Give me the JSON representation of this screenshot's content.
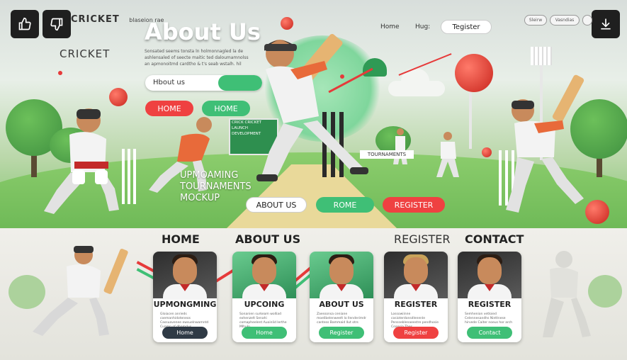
{
  "toolbar": {
    "like_icon": "thumbs-up-icon",
    "dislike_icon": "thumbs-down-icon",
    "download_icon": "download-icon"
  },
  "brand": {
    "name": "CRICKET",
    "tagline": "blaseion rae"
  },
  "hero": {
    "cricket_word": "CRICKET",
    "title": "About Us",
    "subtitle": "Sonsated seems tonsta ln holmonnagled la de ashlensaled of seecte maitic ted daloumamnolss an apmonoitmd cardtho & t's seab wstalh. hil",
    "search_text": "Hbout us",
    "btn_home_red": "HOME",
    "btn_home_green": "HOME",
    "stadium_text": "CRICK CRICKET LAUNCH DEVELOPMENT",
    "tournaments_label": "TOURNAMENTS",
    "upcoming_text": "UPMOAMING TOURNAMENTS MOCKUP",
    "btn_about": "ABOUT US",
    "btn_rome": "ROME",
    "btn_register": "REGISTER"
  },
  "nav": {
    "home": "Home",
    "hug": "Hug:",
    "register": "Tegister",
    "small1": "Sleirw",
    "small2": "Vasndias",
    "small3": ""
  },
  "sections": {
    "home": "HOME",
    "about": "ABOUT US",
    "register": "REGISTER",
    "contact": "CONTACT"
  },
  "cards": [
    {
      "title": "UPMONGMING",
      "lines": "Gloiacen anrieds coemanhidoteneos Cassuavenee ewsuelnwamntd Cuamn of dhamdus",
      "button": "Home"
    },
    {
      "title": "UPCOING",
      "lines": "Sonanien surkeam wolliad exhenzelt Senahi comapheelent Auoinlid lerthe Mlhuln",
      "button": "Home"
    },
    {
      "title": "ABOUT US",
      "lines": "Zaessonsa ceniane moelibelenweelt lo llenderimdr cantess Bammaid llut otrs",
      "button": "Register"
    },
    {
      "title": "REGISTER",
      "lines": "Lossowiinne cosioterdonsdlenenle Pensseblenaeestre pendhosie Coansia Thes",
      "button": "Register"
    },
    {
      "title": "REGISTER",
      "lines": "Semhenion vetloied Celennesandhs Ninttnese hirvede Caiter noeus hor arch",
      "button": "Contact"
    }
  ]
}
